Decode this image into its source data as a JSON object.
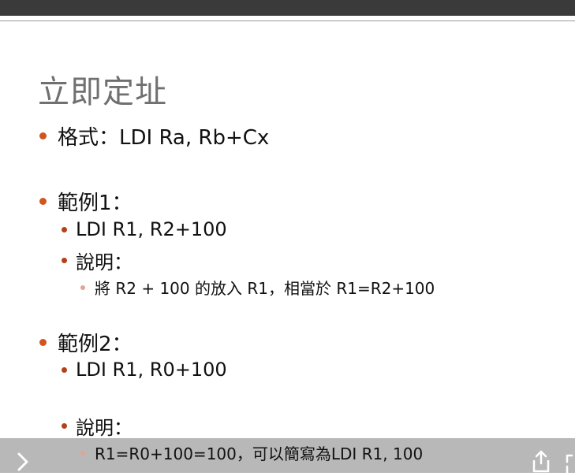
{
  "slide": {
    "title": "立即定址",
    "format": "格式：LDI Ra, Rb+Cx",
    "example1": {
      "heading": "範例1：",
      "code": "LDI R1, R2+100",
      "explain_label": "說明：",
      "explain": "將 R2 + 100 的放入 R1，相當於 R1=R2+100"
    },
    "example2": {
      "heading": "範例2：",
      "code": "LDI R1, R0+100",
      "explain_label": "說明：",
      "explain": "R1=R0+100=100，可以簡寫為LDI R1, 100"
    }
  },
  "colors": {
    "topbar": "#3a3a3a",
    "title": "#707070",
    "bullet_level1": "#d0551f",
    "bullet_level2": "#b4401a",
    "bullet_level3": "#e3a58f",
    "overlay": "#969696"
  },
  "icons": {
    "next": "chevron-right-icon",
    "share": "share-icon",
    "fullscreen": "fullscreen-icon"
  }
}
